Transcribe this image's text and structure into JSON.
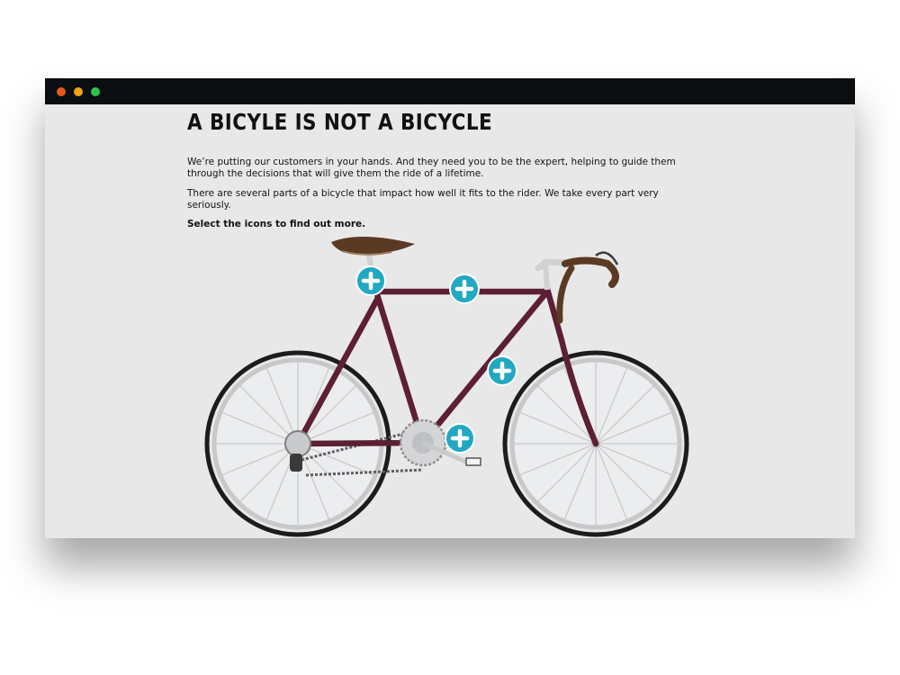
{
  "page": {
    "heading": "A BICYLE IS NOT A BICYCLE",
    "intro": "We’re putting our customers in your hands. And they need you to be the expert, helping to guide them through the decisions that will give them the ride of a lifetime.",
    "body": "There are several parts of a bicycle that impact how well it fits to the rider. We take every part very seriously.",
    "instruction": "Select the icons to find out more."
  },
  "bicycle": {
    "hotspots": [
      "saddle",
      "top-tube",
      "down-tube",
      "crank"
    ],
    "icons": {
      "window_controls": [
        "close-dot",
        "minimize-dot",
        "maximize-dot"
      ],
      "hotspot_icon": "plus-icon"
    }
  },
  "colors": {
    "titlebar": "#0a0e10",
    "background": "#e8e8e9",
    "frame": "#5c1f35",
    "hotspot": "#23a8c3",
    "saddle": "#5a3a22",
    "tire": "#1c1c1c",
    "rim": "#c7c8ca"
  }
}
